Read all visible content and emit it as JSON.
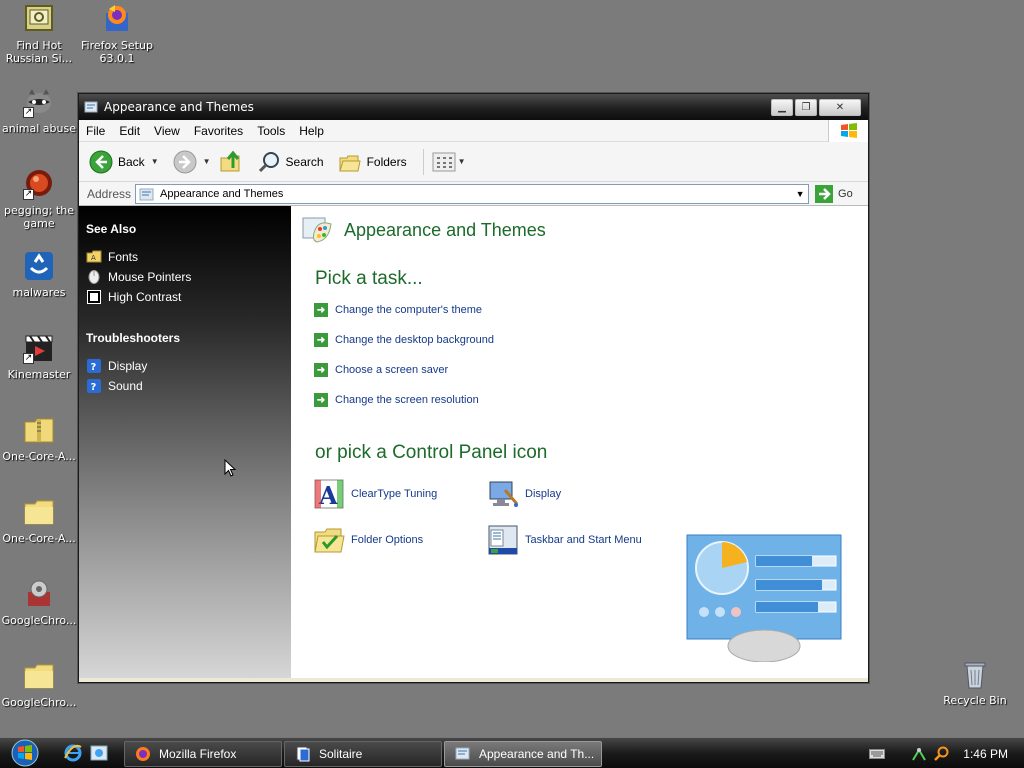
{
  "desktop": {
    "icons_left": [
      {
        "label": "Find Hot Russian Si...",
        "icon": "certificate-icon"
      },
      {
        "label": "animal abuse",
        "icon": "raccoon-icon"
      },
      {
        "label": "pegging; the game",
        "icon": "red-ball-icon"
      },
      {
        "label": "malwares",
        "icon": "malware-app-icon"
      },
      {
        "label": "Kinemaster",
        "icon": "clapperboard-icon"
      },
      {
        "label": "One-Core-A...",
        "icon": "zip-folder-icon"
      },
      {
        "label": "One-Core-A...",
        "icon": "folder-icon"
      },
      {
        "label": "GoogleChro...",
        "icon": "installer-icon"
      },
      {
        "label": "GoogleChro...",
        "icon": "folder-icon"
      }
    ],
    "firefox_setup": {
      "label": "Firefox Setup 63.0.1",
      "icon": "firefox-setup-icon"
    },
    "recycle_bin": {
      "label": "Recycle Bin",
      "icon": "recycle-bin-icon"
    }
  },
  "window": {
    "title": "Appearance and Themes",
    "menu": [
      "File",
      "Edit",
      "View",
      "Favorites",
      "Tools",
      "Help"
    ],
    "toolbar": {
      "back": "Back",
      "search": "Search",
      "folders": "Folders"
    },
    "address": {
      "label": "Address",
      "value": "Appearance and Themes",
      "go": "Go"
    },
    "sidebar": {
      "see_also_title": "See Also",
      "see_also": [
        "Fonts",
        "Mouse Pointers",
        "High Contrast"
      ],
      "troubleshooters_title": "Troubleshooters",
      "troubleshooters": [
        "Display",
        "Sound"
      ]
    },
    "main": {
      "heading": "Appearance and Themes",
      "pick_task": "Pick a task...",
      "tasks": [
        "Change the computer's theme",
        "Change the desktop background",
        "Choose a screen saver",
        "Change the screen resolution"
      ],
      "cp_heading": "or pick a Control Panel icon",
      "cp_icons": [
        "ClearType Tuning",
        "Display",
        "Folder Options",
        "Taskbar and Start Menu"
      ]
    }
  },
  "taskbar": {
    "buttons": [
      "Mozilla Firefox",
      "Solitaire",
      "Appearance and Th..."
    ],
    "clock": "1:46 PM"
  },
  "colors": {
    "desktop_bg": "#7b7b7b",
    "heading_green": "#1c6b2a",
    "link_blue": "#153a8a"
  }
}
